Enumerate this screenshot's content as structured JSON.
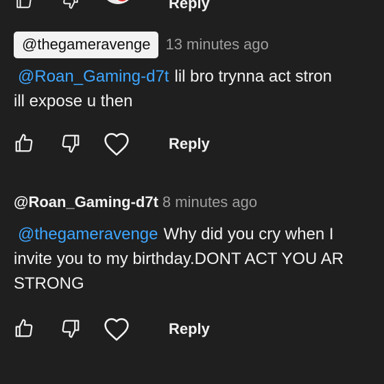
{
  "top": {
    "reply_label": "Reply"
  },
  "comments": [
    {
      "author": "@thegameravenge",
      "time": "13 minutes ago",
      "mention": "@Roan_Gaming-d7t",
      "line1": "lil bro trynna act stron",
      "line2": "ill expose u then",
      "reply_label": "Reply"
    },
    {
      "author": "@Roan_Gaming-d7t",
      "time": "8 minutes ago",
      "mention": "@thegameravenge",
      "line1": "Why did you cry when I",
      "line2": "invite you to my birthday.DONT ACT YOU AR",
      "line3": "STRONG",
      "reply_label": "Reply"
    }
  ],
  "icons": [
    "thumb-up-icon",
    "thumb-down-icon",
    "heart-icon"
  ],
  "colors": {
    "background": "#1f1f1f",
    "mention": "#3ea6ff",
    "muted": "#9f9f9f",
    "chip": "#f2f2f2"
  }
}
